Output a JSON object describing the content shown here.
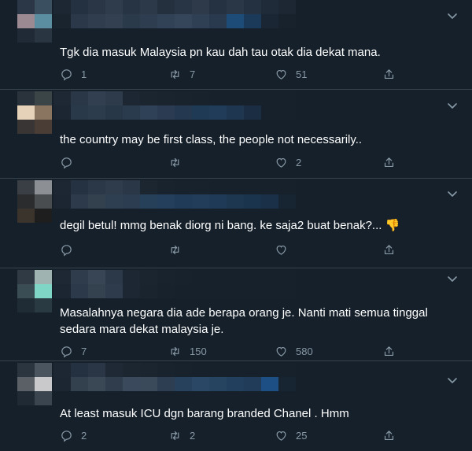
{
  "tweets": [
    {
      "text": "Tgk dia masuk Malaysia pn kau dah tau otak dia dekat mana.",
      "replies": "1",
      "retweets": "7",
      "likes": "51",
      "emoji": ""
    },
    {
      "text": "the country may be first class, the people not necessarily..",
      "replies": "",
      "retweets": "",
      "likes": "2",
      "emoji": ""
    },
    {
      "text": "degil betul! mmg benak diorg ni bang. ke saja2 buat benak?...",
      "replies": "",
      "retweets": "",
      "likes": "",
      "emoji": "👎"
    },
    {
      "text": "Masalahnya negara dia ade berapa orang je. Nanti mati semua tinggal sedara mara dekat malaysia je.",
      "replies": "7",
      "retweets": "150",
      "likes": "580",
      "emoji": ""
    },
    {
      "text": "At least masuk ICU dgn barang branded Chanel . Hmm",
      "replies": "2",
      "retweets": "2",
      "likes": "25",
      "emoji": ""
    }
  ],
  "icons": {
    "more": "chevron-down-icon",
    "reply": "reply-icon",
    "retweet": "retweet-icon",
    "like": "heart-icon",
    "share": "share-icon"
  },
  "colors": {
    "background": "#15202b",
    "divider": "#38444d",
    "muted": "#8899a6",
    "text": "#ffffff"
  }
}
